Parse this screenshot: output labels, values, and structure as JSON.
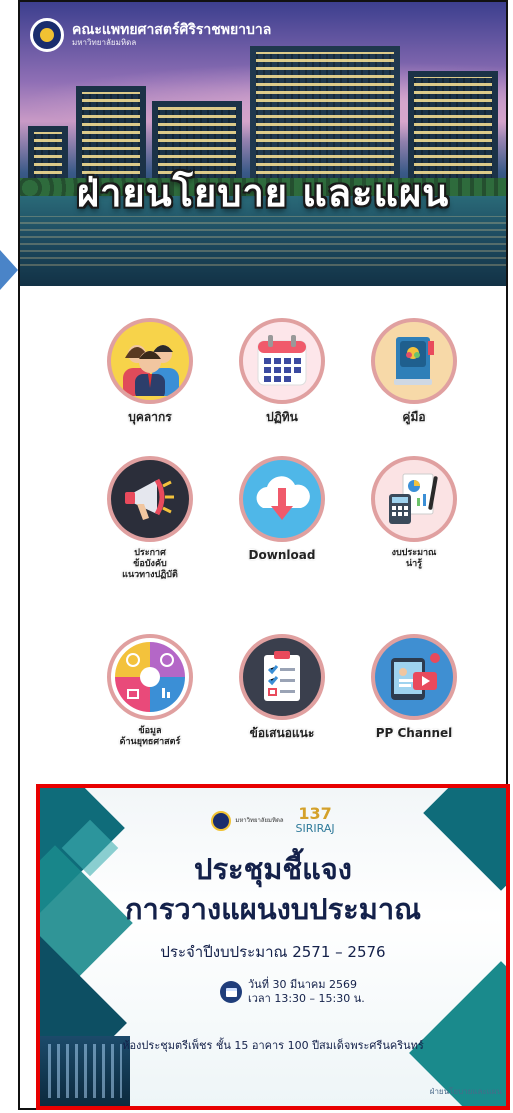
{
  "header": {
    "faculty_name": "คณะแพทยศาสตร์ศิริราชพยาบาล",
    "university_name": "มหาวิทยาลัยมหิดล",
    "banner_title": "ฝ่ายนโยบาย และแผน"
  },
  "menu": {
    "items": [
      {
        "label": "บุคลากร",
        "icon": "people-icon"
      },
      {
        "label": "ปฏิทิน",
        "icon": "calendar-icon"
      },
      {
        "label": "คู่มือ",
        "icon": "book-icon"
      },
      {
        "label": "ประกาศ\nข้อบังคับ\nแนวทางปฏิบัติ",
        "icon": "megaphone-icon"
      },
      {
        "label": "Download",
        "icon": "cloud-download-icon"
      },
      {
        "label": "งบประมาณ\nน่ารู้",
        "icon": "budget-calculator-icon"
      },
      {
        "label": "ข้อมูล\nด้านยุทธศาสตร์",
        "icon": "strategy-icon"
      },
      {
        "label": "ข้อเสนอแนะ",
        "icon": "clipboard-checklist-icon"
      },
      {
        "label": "PP Channel",
        "icon": "video-channel-icon"
      }
    ]
  },
  "announcement": {
    "org_small": "มหาวิทยาลัยมหิดล",
    "anniversary": "137",
    "siriraj": "SIRIRAJ",
    "title_line1": "ประชุมชี้แจง",
    "title_line2": "การวางแผนงบประมาณ",
    "fiscal_years": "ประจำปีงบประมาณ 2571 – 2576",
    "date": "วันที่ 30 มีนาคม 2569",
    "time": "เวลา 13:30 – 15:30 น.",
    "venue": "ห้องประชุมตรีเพ็ชร ชั้น 15 อาคาร 100 ปีสมเด็จพระศรีนครินทร์",
    "footer": "ฝ่ายนโยบายและแผน"
  },
  "colors": {
    "highlight_border": "#e80000",
    "nav_arrow": "#4a84c8",
    "title_navy": "#14214a"
  }
}
